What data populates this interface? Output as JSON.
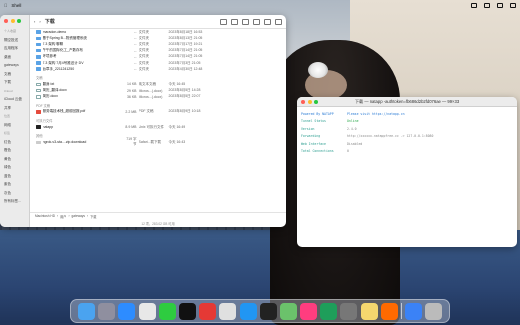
{
  "menubar": {
    "app": "Shell",
    "right_date": "",
    "right_time": ""
  },
  "finder": {
    "title": "下载",
    "sidebar": [
      {
        "label": "个人收藏",
        "head": true
      },
      {
        "label": "隔空投送"
      },
      {
        "label": "应用程序"
      },
      {
        "label": "桌面"
      },
      {
        "label": "gateways"
      },
      {
        "label": "文稿"
      },
      {
        "label": "下载"
      },
      {
        "label": "iCloud",
        "head": true
      },
      {
        "label": "iCloud 云盘"
      },
      {
        "label": "共享"
      },
      {
        "label": "位置",
        "head": true
      },
      {
        "label": "网络"
      },
      {
        "label": "标签",
        "head": true
      },
      {
        "label": "红色"
      },
      {
        "label": "橙色"
      },
      {
        "label": "黄色"
      },
      {
        "label": "绿色"
      },
      {
        "label": "蓝色"
      },
      {
        "label": "紫色"
      },
      {
        "label": "灰色"
      },
      {
        "label": "所有标签..."
      }
    ],
    "groups": [
      {
        "label": "",
        "rows": [
          {
            "icon": "folder",
            "name": "maradon-demo",
            "size": "--",
            "kind": "文件夹",
            "date": "2023年8月18日 16:53"
          },
          {
            "icon": "folder",
            "name": "基于Spring B...物资管理系统",
            "size": "--",
            "kind": "文件夹",
            "date": "2023年8月13日 21:05"
          },
          {
            "icon": "folder",
            "name": "7.3 架构 聊聊",
            "size": "--",
            "kind": "文件夹",
            "date": "2023年7月17日 19:21"
          },
          {
            "icon": "folder",
            "name": "午午的国际化工_产数存布",
            "size": "--",
            "kind": "文件夹",
            "date": "2023年7月14日 21:05"
          },
          {
            "icon": "folder",
            "name": "环境参考",
            "size": "--",
            "kind": "文件夹",
            "date": "2023年7月14日 21:05"
          },
          {
            "icon": "folder",
            "name": "7.3 架构 7月4号推迟计 DV",
            "size": "--",
            "kind": "文件夹",
            "date": "2023年7月3日 21:05"
          },
          {
            "icon": "folder",
            "name": "台章手_2211241250",
            "size": "--",
            "kind": "文件夹",
            "date": "2023年4月30日 12:48"
          }
        ]
      },
      {
        "label": "文稿",
        "rows": [
          {
            "icon": "doc",
            "name": "翻身.txt",
            "size": "14 KB",
            "kind": "纯文本文稿",
            "date": "今天 16:45"
          },
          {
            "icon": "doc",
            "name": "简历_翻译.docx",
            "size": "29 KB",
            "kind": "Micros...(.docx)",
            "date": "2023年8月5日 14:28"
          },
          {
            "icon": "doc",
            "name": "简历.docx",
            "size": "36 KB",
            "kind": "Micros...(.docx)",
            "date": "2023年8月5日 22:07"
          }
        ]
      },
      {
        "label": "PDF 文稿",
        "rows": [
          {
            "icon": "pdf",
            "name": "服务端技术栈_超前回报.pdf",
            "size": "2.2 MB",
            "kind": "PDF 文稿",
            "date": "2023年8月9日 10:18"
          }
        ]
      },
      {
        "label": "可执行文件",
        "rows": [
          {
            "icon": "app",
            "name": "natapp",
            "size": "8.9 MB",
            "kind": "Unix 可执行文件",
            "date": "今天 16:49"
          }
        ]
      },
      {
        "label": "其他",
        "rows": [
          {
            "icon": "dl",
            "name": "ngrok-v3-sta....zip.download",
            "size": "719 字节",
            "kind": "Safari...载下载",
            "date": "今天 16:43"
          }
        ]
      }
    ],
    "path": [
      "Macintosh HD",
      "用户",
      "gateways",
      "下载"
    ],
    "status": "12 项，283.02 GB 可用"
  },
  "terminal": {
    "title": "下载 — natapp -authtoken=fb686d2b2fd076ae — 99×33",
    "lines": [
      {
        "k": "Powered By NATAPP",
        "v": "Please visit https://natapp.cn",
        "hd": true
      },
      {
        "k": "Tunnel Status",
        "v": "Online",
        "on": true
      },
      {
        "k": "Version",
        "v": "2.4.0"
      },
      {
        "k": "Forwarding",
        "v": "http://xxxxxx.natappfree.cc -> 127.0.0.1:8080"
      },
      {
        "k": "Web Interface",
        "v": "Disabled"
      },
      {
        "k": "Total Connections",
        "v": "0"
      }
    ]
  },
  "dock": [
    "Finder",
    "Launchpad",
    "Safari",
    "Chrome",
    "WeChat",
    "QQ",
    "WPS",
    "PDF",
    "Safari",
    "Terminal",
    "Maps",
    "IntelliJ",
    "PyCharm",
    "Settings",
    "Notes",
    "Xiaomi",
    "Downloads",
    "Trash"
  ]
}
